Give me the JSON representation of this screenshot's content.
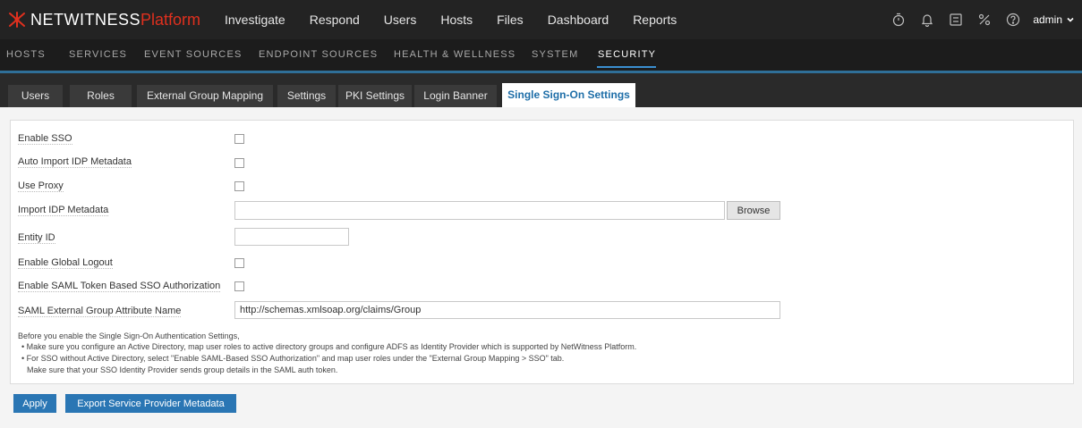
{
  "topbar": {
    "brand": "NETWITNESS",
    "brand_suffix": "Platform",
    "nav": [
      "Investigate",
      "Respond",
      "Users",
      "Hosts",
      "Files",
      "Dashboard",
      "Reports"
    ],
    "user": "admin",
    "icons": [
      "timer-icon",
      "bell-icon",
      "checklist-icon",
      "tools-icon",
      "help-icon"
    ]
  },
  "subnav": [
    "HOSTS",
    "SERVICES",
    "EVENT SOURCES",
    "ENDPOINT SOURCES",
    "HEALTH & WELLNESS",
    "SYSTEM",
    "SECURITY"
  ],
  "subnav_active": "SECURITY",
  "tabs": [
    "Users",
    "Roles",
    "External Group Mapping",
    "Settings",
    "PKI Settings",
    "Login Banner",
    "Single Sign-On Settings"
  ],
  "tabs_active": "Single Sign-On Settings",
  "form": {
    "enable_sso_label": "Enable SSO",
    "auto_import_label": "Auto Import IDP Metadata",
    "use_proxy_label": "Use Proxy",
    "import_idp_label": "Import IDP Metadata",
    "import_idp_value": "",
    "browse_label": "Browse",
    "entity_id_label": "Entity ID",
    "entity_id_value": "",
    "global_logout_label": "Enable Global Logout",
    "saml_token_label": "Enable SAML Token Based SSO Authorization",
    "saml_attr_label": "SAML External Group Attribute Name",
    "saml_attr_value": "http://schemas.xmlsoap.org/claims/Group"
  },
  "notes": [
    "Before you enable the Single Sign-On Authentication Settings,",
    "• Make sure you configure an Active Directory, map user roles to active directory groups and configure ADFS as Identity Provider which is supported by NetWitness Platform.",
    "• For SSO without Active Directory, select \"Enable SAML-Based SSO Authorization\" and map user roles under the \"External Group Mapping > SSO\" tab.",
    "Make sure that your SSO Identity Provider sends group details in the SAML auth token."
  ],
  "actions": {
    "apply_label": "Apply",
    "export_label": "Export Service Provider Metadata"
  },
  "colors": {
    "topbar": "#232323",
    "brand_accent": "#e0301e",
    "tab_active_text": "#1e6ea8",
    "button": "#2a76b4"
  }
}
